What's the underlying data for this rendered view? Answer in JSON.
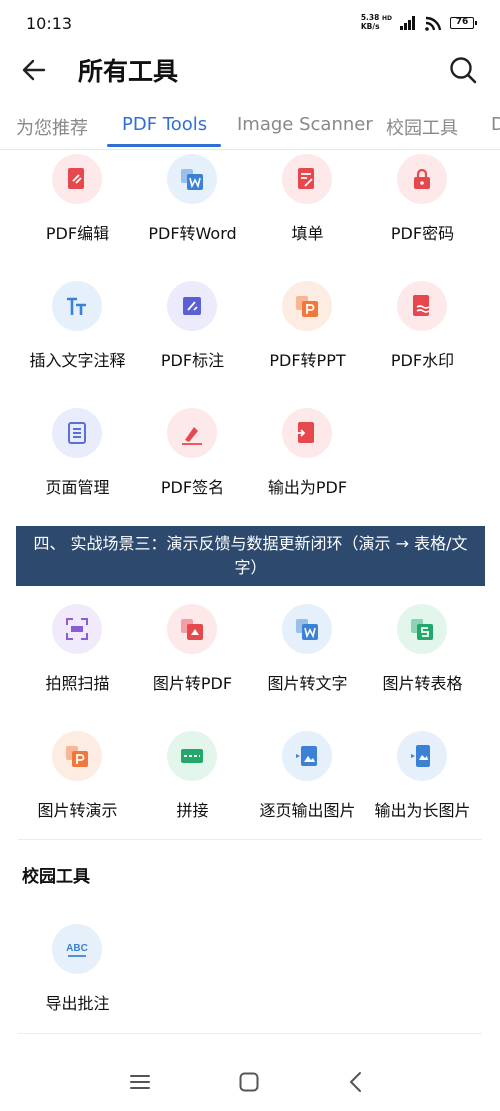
{
  "status": {
    "time": "10:13",
    "net_speed_value": "5.38",
    "net_speed_unit": "KB/s",
    "net_type": "HD",
    "battery": "76"
  },
  "header": {
    "title": "所有工具"
  },
  "tabs": [
    {
      "label": "为您推荐"
    },
    {
      "label": "PDF Tools"
    },
    {
      "label": "Image Scanner"
    },
    {
      "label": "校园工具"
    },
    {
      "label": "D"
    }
  ],
  "pdf_tools": [
    {
      "label": "PDF编辑",
      "icon": "pdf-edit-icon",
      "color": "#e5484d",
      "bg": "#fde9ea"
    },
    {
      "label": "PDF转Word",
      "icon": "pdf-to-word-icon",
      "color": "#3b82d6",
      "bg": "#e6f0fb"
    },
    {
      "label": "填单",
      "icon": "fill-form-icon",
      "color": "#e5484d",
      "bg": "#fde9ea"
    },
    {
      "label": "PDF密码",
      "icon": "lock-icon",
      "color": "#e5484d",
      "bg": "#fde9ea"
    },
    {
      "label": "插入文字注释",
      "icon": "text-annotation-icon",
      "color": "#3b82d6",
      "bg": "#e6f0fb"
    },
    {
      "label": "PDF标注",
      "icon": "pdf-markup-icon",
      "color": "#5b5fd6",
      "bg": "#ecebfb"
    },
    {
      "label": "PDF转PPT",
      "icon": "pdf-to-ppt-icon",
      "color": "#f0783c",
      "bg": "#fdece2"
    },
    {
      "label": "PDF水印",
      "icon": "watermark-icon",
      "color": "#e5484d",
      "bg": "#fde9ea"
    },
    {
      "label": "页面管理",
      "icon": "page-manage-icon",
      "color": "#5b6fd6",
      "bg": "#e9ecfb"
    },
    {
      "label": "PDF签名",
      "icon": "signature-icon",
      "color": "#e5484d",
      "bg": "#fde9ea"
    },
    {
      "label": "输出为PDF",
      "icon": "export-pdf-icon",
      "color": "#e5484d",
      "bg": "#fde9ea"
    }
  ],
  "banner": {
    "text": "四、 实战场景三：演示反馈与数据更新闭环（演示 → 表格/文字）"
  },
  "image_tools": [
    {
      "label": "拍照扫描",
      "icon": "scan-icon",
      "color": "#8b5cd6",
      "bg": "#f1eafb"
    },
    {
      "label": "图片转PDF",
      "icon": "image-to-pdf-icon",
      "color": "#e5484d",
      "bg": "#fde9ea"
    },
    {
      "label": "图片转文字",
      "icon": "image-to-text-icon",
      "color": "#3b82d6",
      "bg": "#e6f0fb"
    },
    {
      "label": "图片转表格",
      "icon": "image-to-sheet-icon",
      "color": "#22a86b",
      "bg": "#e3f6ec"
    },
    {
      "label": "图片转演示",
      "icon": "image-to-ppt-icon",
      "color": "#f0783c",
      "bg": "#fdece2"
    },
    {
      "label": "拼接",
      "icon": "stitch-icon",
      "color": "#22a86b",
      "bg": "#e3f6ec"
    },
    {
      "label": "逐页输出图片",
      "icon": "export-images-icon",
      "color": "#3b82d6",
      "bg": "#e6f0fb"
    },
    {
      "label": "输出为长图片",
      "icon": "long-image-icon",
      "color": "#3b82d6",
      "bg": "#e6f0fb"
    }
  ],
  "campus": {
    "title": "校园工具",
    "tools": [
      {
        "label": "导出批注",
        "icon": "export-annotation-icon",
        "color": "#3b82d6",
        "bg": "#e6f0fb"
      }
    ]
  }
}
